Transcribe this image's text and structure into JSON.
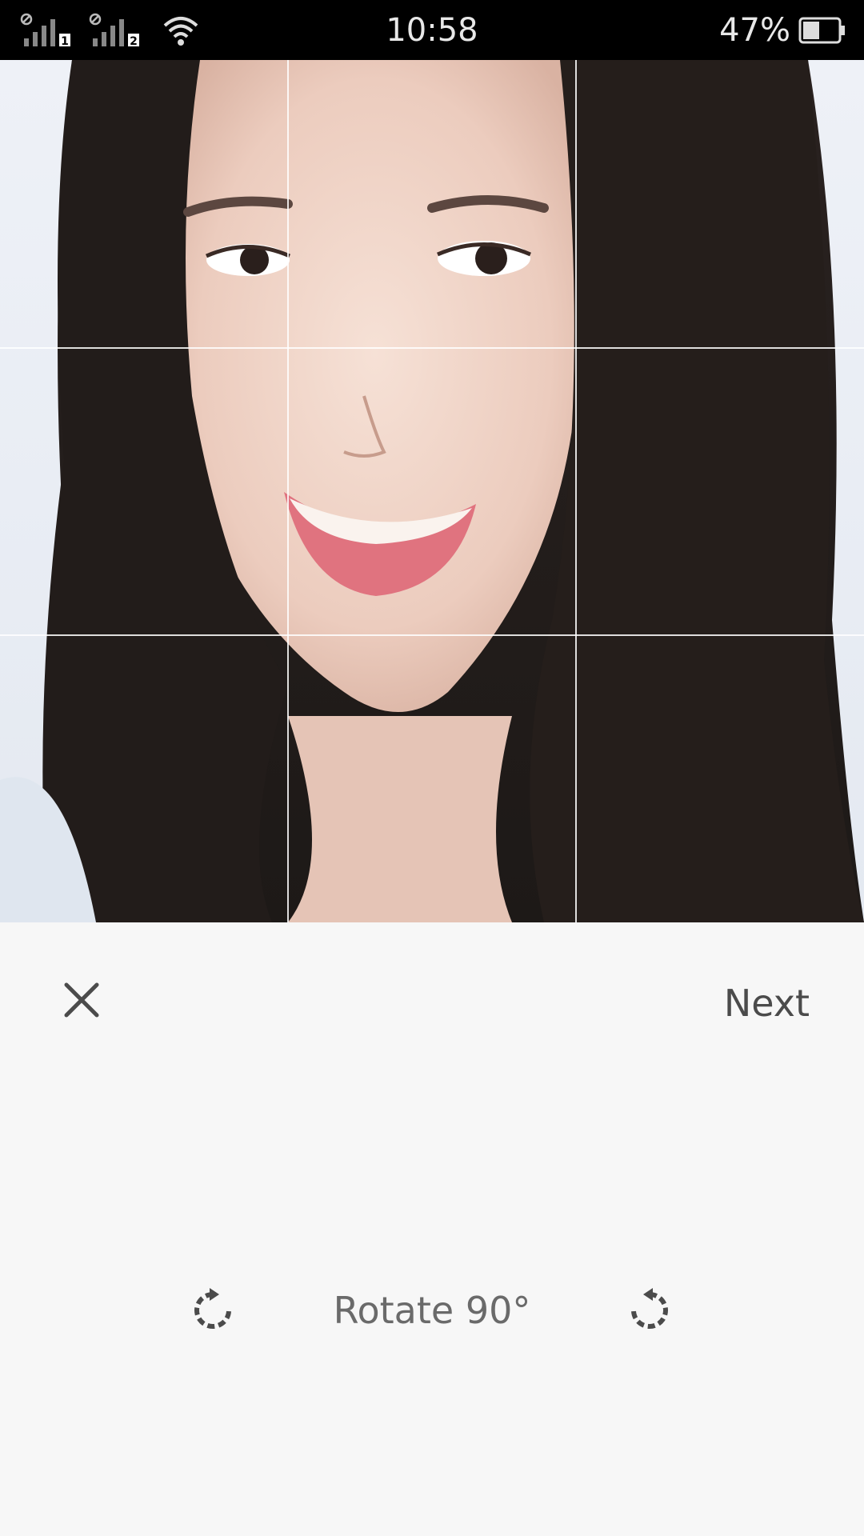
{
  "status_bar": {
    "time": "10:58",
    "battery_percent": "47%",
    "battery_level": 0.47,
    "sim1_label": "1",
    "sim2_label": "2"
  },
  "photo": {
    "description_icon": "portrait-photo",
    "grid": "3x3"
  },
  "actions": {
    "close_icon": "close-icon",
    "next_label": "Next"
  },
  "rotate": {
    "label": "Rotate 90°",
    "cw_icon": "rotate-clockwise-icon",
    "ccw_icon": "rotate-counterclockwise-icon"
  },
  "colors": {
    "status_bar_bg": "#000000",
    "panel_bg": "#f7f7f7",
    "text_primary": "#4b4b4b",
    "text_secondary": "#6a6a6a"
  }
}
